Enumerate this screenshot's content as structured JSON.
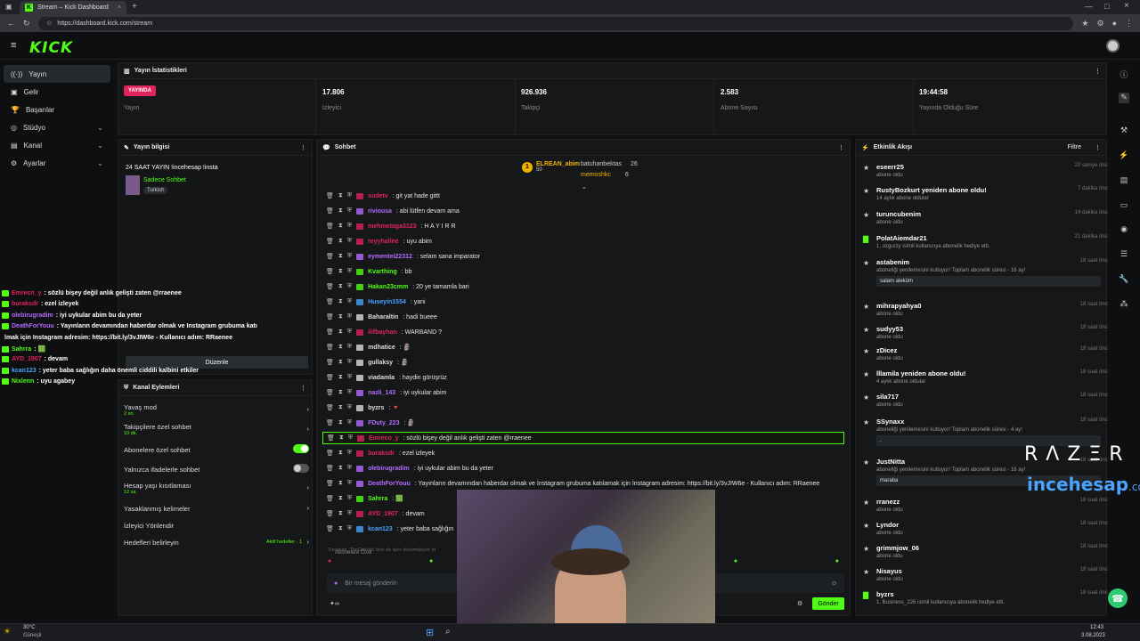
{
  "browser": {
    "tab_title": "Stream – Kick Dashboard",
    "url": "https://dashboard.kick.com/stream",
    "new_tab": "+"
  },
  "brand": {
    "logo": "KICK",
    "accent": "#53fc18",
    "live_color": "#e0245e"
  },
  "sidebar": {
    "items": [
      {
        "label": "Yayın",
        "icon": "broadcast-icon",
        "active": true
      },
      {
        "label": "Gelir",
        "icon": "revenue-icon"
      },
      {
        "label": "Başarılar",
        "icon": "trophy-icon"
      },
      {
        "label": "Stüdyo",
        "icon": "studio-icon",
        "expandable": true
      },
      {
        "label": "Kanal",
        "icon": "channel-icon",
        "expandable": true
      },
      {
        "label": "Ayarlar",
        "icon": "settings-icon",
        "expandable": true
      }
    ]
  },
  "stats": {
    "title": "Yayın İstatistikleri",
    "live_badge": "YAYINDA",
    "live_label": "Yayın",
    "viewers": "17.806",
    "viewers_label": "İzleyici",
    "followers": "926.936",
    "followers_label": "Takipçi",
    "subs": "2.583",
    "subs_label": "Abone Sayısı",
    "uptime": "19:44:58",
    "uptime_label": "Yayında Olduğu Süre"
  },
  "stream_info": {
    "title": "Yayın bilgisi",
    "stream_title": "24 SAAT YAYIN !incehesap !insta",
    "category": "Sadece Sohbet",
    "tag": "Turkish",
    "edit_button": "Düzenle"
  },
  "channel_actions": {
    "title": "Kanal Eylemleri",
    "items": [
      {
        "label": "Yavaş mod",
        "sub": "2 sn."
      },
      {
        "label": "Takipçilere özel sohbet",
        "sub": "10 dk."
      },
      {
        "label": "Abonelere özel sohbet",
        "toggle": "on"
      },
      {
        "label": "Yalnızca ifadelerle sohbet",
        "toggle": "off"
      },
      {
        "label": "Hesap yaşı kısıtlaması",
        "sub": "12 sa."
      },
      {
        "label": "Yasaklanmış kelimeler"
      },
      {
        "label": "İzleyici Yönlendir"
      },
      {
        "label": "Hedefleri belirleyin",
        "note": "Aktif hedefler · 1"
      }
    ]
  },
  "chat": {
    "title": "Sohbet",
    "pinned": [
      {
        "rank": "1",
        "name": "ELREAN_abim",
        "count": "50"
      },
      {
        "name": "batuhanbektas",
        "count": "26"
      },
      {
        "name": "memoshkc",
        "count": "6"
      }
    ],
    "messages": [
      {
        "user": "sudetv",
        "color": "#e0245e",
        "text": ": git yat hade gittt"
      },
      {
        "user": "riviousa",
        "color": "#b36bff",
        "text": ": abi lütfen devam ama"
      },
      {
        "user": "mehmetaga3123",
        "color": "#e0245e",
        "text": ": H A Y I R R"
      },
      {
        "user": "reyyhaline",
        "color": "#e0245e",
        "text": ": uyu abim"
      },
      {
        "user": "eymentei22312",
        "color": "#b36bff",
        "text": ": selam sana imparator"
      },
      {
        "user": "Kvarthing",
        "color": "#53fc18",
        "text": ": bb"
      },
      {
        "user": "Hakan23cmm",
        "color": "#53fc18",
        "text": ": 20 ye tamamla bari"
      },
      {
        "user": "Huseyin1554",
        "color": "#4aa3ff",
        "text": ": yani"
      },
      {
        "user": "Baharaltin",
        "color": "#ddd",
        "text": ": hadi bueee"
      },
      {
        "user": "ilifbayhan",
        "color": "#e0245e",
        "text": ": WARBAND ?"
      },
      {
        "user": "mdhatice",
        "color": "#ddd",
        "text": ": 🗿"
      },
      {
        "user": "gullaksy",
        "color": "#ddd",
        "text": ": 🗿"
      },
      {
        "user": "viadamla",
        "color": "#ddd",
        "text": ": haydin görüşrüz"
      },
      {
        "user": "nazli_143",
        "color": "#b36bff",
        "text": ": iyi uykular abim"
      },
      {
        "user": "byzrs",
        "color": "#ddd",
        "text": ": 🔻"
      },
      {
        "user": "FDuty_223",
        "color": "#b36bff",
        "text": ": 🗿"
      },
      {
        "user": "Emrecn_y",
        "color": "#e0245e",
        "text": ": sözlü bişey değil anlık gelişti zaten @rraenee",
        "highlight": true
      },
      {
        "user": "buraksdr",
        "color": "#e0245e",
        "text": ": ezel izleyek"
      },
      {
        "user": "olebirugradim",
        "color": "#b36bff",
        "text": ": iyi uykular abim bu da yeter"
      },
      {
        "user": "DeathForYouu",
        "color": "#b36bff",
        "text": ": Yayınların devamından haberdar olmak ve İnstagram grubuma katılamak için İnstagram adresim: https://bit.ly/3vJIW6e - Kullanıcı adım: RRaenee"
      },
      {
        "user": "Sahrra",
        "color": "#53fc18",
        "text": ": 🟩"
      },
      {
        "user": "AYD_1907",
        "color": "#e0245e",
        "text": ": devam"
      },
      {
        "user": "kcan123",
        "color": "#4aa3ff",
        "text": ": yeter baba sağlığın"
      }
    ],
    "reply_hint": "Tunahan_TheDeltoid: ben de aynı durumdayım m",
    "subs_only_label": "Abonelere Özel",
    "input_placeholder": "Bir mesaj gönderin",
    "send_button": "Gönder"
  },
  "activity": {
    "title": "Etkinlik Akışı",
    "filter": "Filtre",
    "items": [
      {
        "name": "eseerr25",
        "sub": "abone oldu",
        "time": "20 saniye önce"
      },
      {
        "name": "RustyBozkurt yeniden abone oldu!",
        "sub": "14 aylık abone oldular",
        "time": "7 dakika önce"
      },
      {
        "name": "turuncubenim",
        "sub": "abone oldu",
        "time": "14 dakika önce"
      },
      {
        "name": "PolatAiemdar21",
        "sub": "1, ozgurzy isimli kullanıcıya abonelik hediye etti.",
        "time": "21 dakika önce"
      },
      {
        "name": "astabenim",
        "sub": "aboneliği yenilemesini kutluyor! Toplam abonelik süresi - 16 ay!",
        "time": "18 saat önce",
        "msg": "salam aleküm"
      },
      {
        "name": "mihrapyahya0",
        "sub": "abone oldu",
        "time": "18 saat önce"
      },
      {
        "name": "sudyy53",
        "sub": "abone oldu",
        "time": "18 saat önce"
      },
      {
        "name": "zDicez",
        "sub": "abone oldu",
        "time": "18 saat önce"
      },
      {
        "name": "lllamila yeniden abone oldu!",
        "sub": "4 aylık abone oldular",
        "time": "18 saat önce"
      },
      {
        "name": "sila717",
        "sub": "abone oldu",
        "time": "18 saat önce"
      },
      {
        "name": "SSynaxx",
        "sub": "aboneliği yenilemesini kutluyor! Toplam abonelik süresi - 4 ay!",
        "time": "18 saat önce",
        "msg": "."
      },
      {
        "name": "JustNitta",
        "sub": "aboneliği yenilemesini kutluyor! Toplam abonelik süresi - 16 ay!",
        "time": "18 saat önce",
        "msg": "maraba"
      },
      {
        "name": "rranezz",
        "sub": "abone oldu",
        "time": "18 saat önce"
      },
      {
        "name": "Lyndor",
        "sub": "abone oldu",
        "time": "18 saat önce"
      },
      {
        "name": "grimmjow_06",
        "sub": "abone oldu",
        "time": "18 saat önce"
      },
      {
        "name": "Nisayus",
        "sub": "abone oldu",
        "time": "18 saat önce"
      },
      {
        "name": "byzrs",
        "sub": "1, Business_226 isimli kullanıcıya abonelik hediye etti.",
        "time": "18 saat önce"
      }
    ]
  },
  "overlay_chat": [
    {
      "user": "Emrecn_y",
      "color": "#e0245e",
      "text": ": sözlü bişey değil anlık gelişti zaten @rraenee"
    },
    {
      "user": "buraksdr",
      "color": "#e0245e",
      "text": ": ezel izleyek"
    },
    {
      "user": "olebirugradim",
      "color": "#b36bff",
      "text": ": iyi uykular abim bu da yeter"
    },
    {
      "user": "DeathForYouu",
      "color": "#b36bff",
      "text": ": Yayınların devamından haberdar olmak ve Instagram grubuma katı"
    },
    {
      "user": "",
      "color": "#fff",
      "text": "lmak için Instagram adresim: https://bit.ly/3vJIW6e - Kullanıcı adım: RRaenee"
    },
    {
      "user": "Sahrra",
      "color": "#53fc18",
      "text": ": 🟩"
    },
    {
      "user": "AYD_1907",
      "color": "#e0245e",
      "text": ": devam"
    },
    {
      "user": "kcan123",
      "color": "#4aa3ff",
      "text": ": yeter baba sağlığın daha önemli ciddili kalbini etkiler"
    },
    {
      "user": "Nixlenn",
      "color": "#53fc18",
      "text": ": uyu agabey"
    }
  ],
  "sponsor": {
    "razer": "RΛZΞR",
    "incehesap": "incehesap",
    "domain": ".com"
  },
  "taskbar": {
    "temp": "30°C",
    "weather": "Güneşli",
    "time": "12:43",
    "date": "3.08.2023"
  }
}
